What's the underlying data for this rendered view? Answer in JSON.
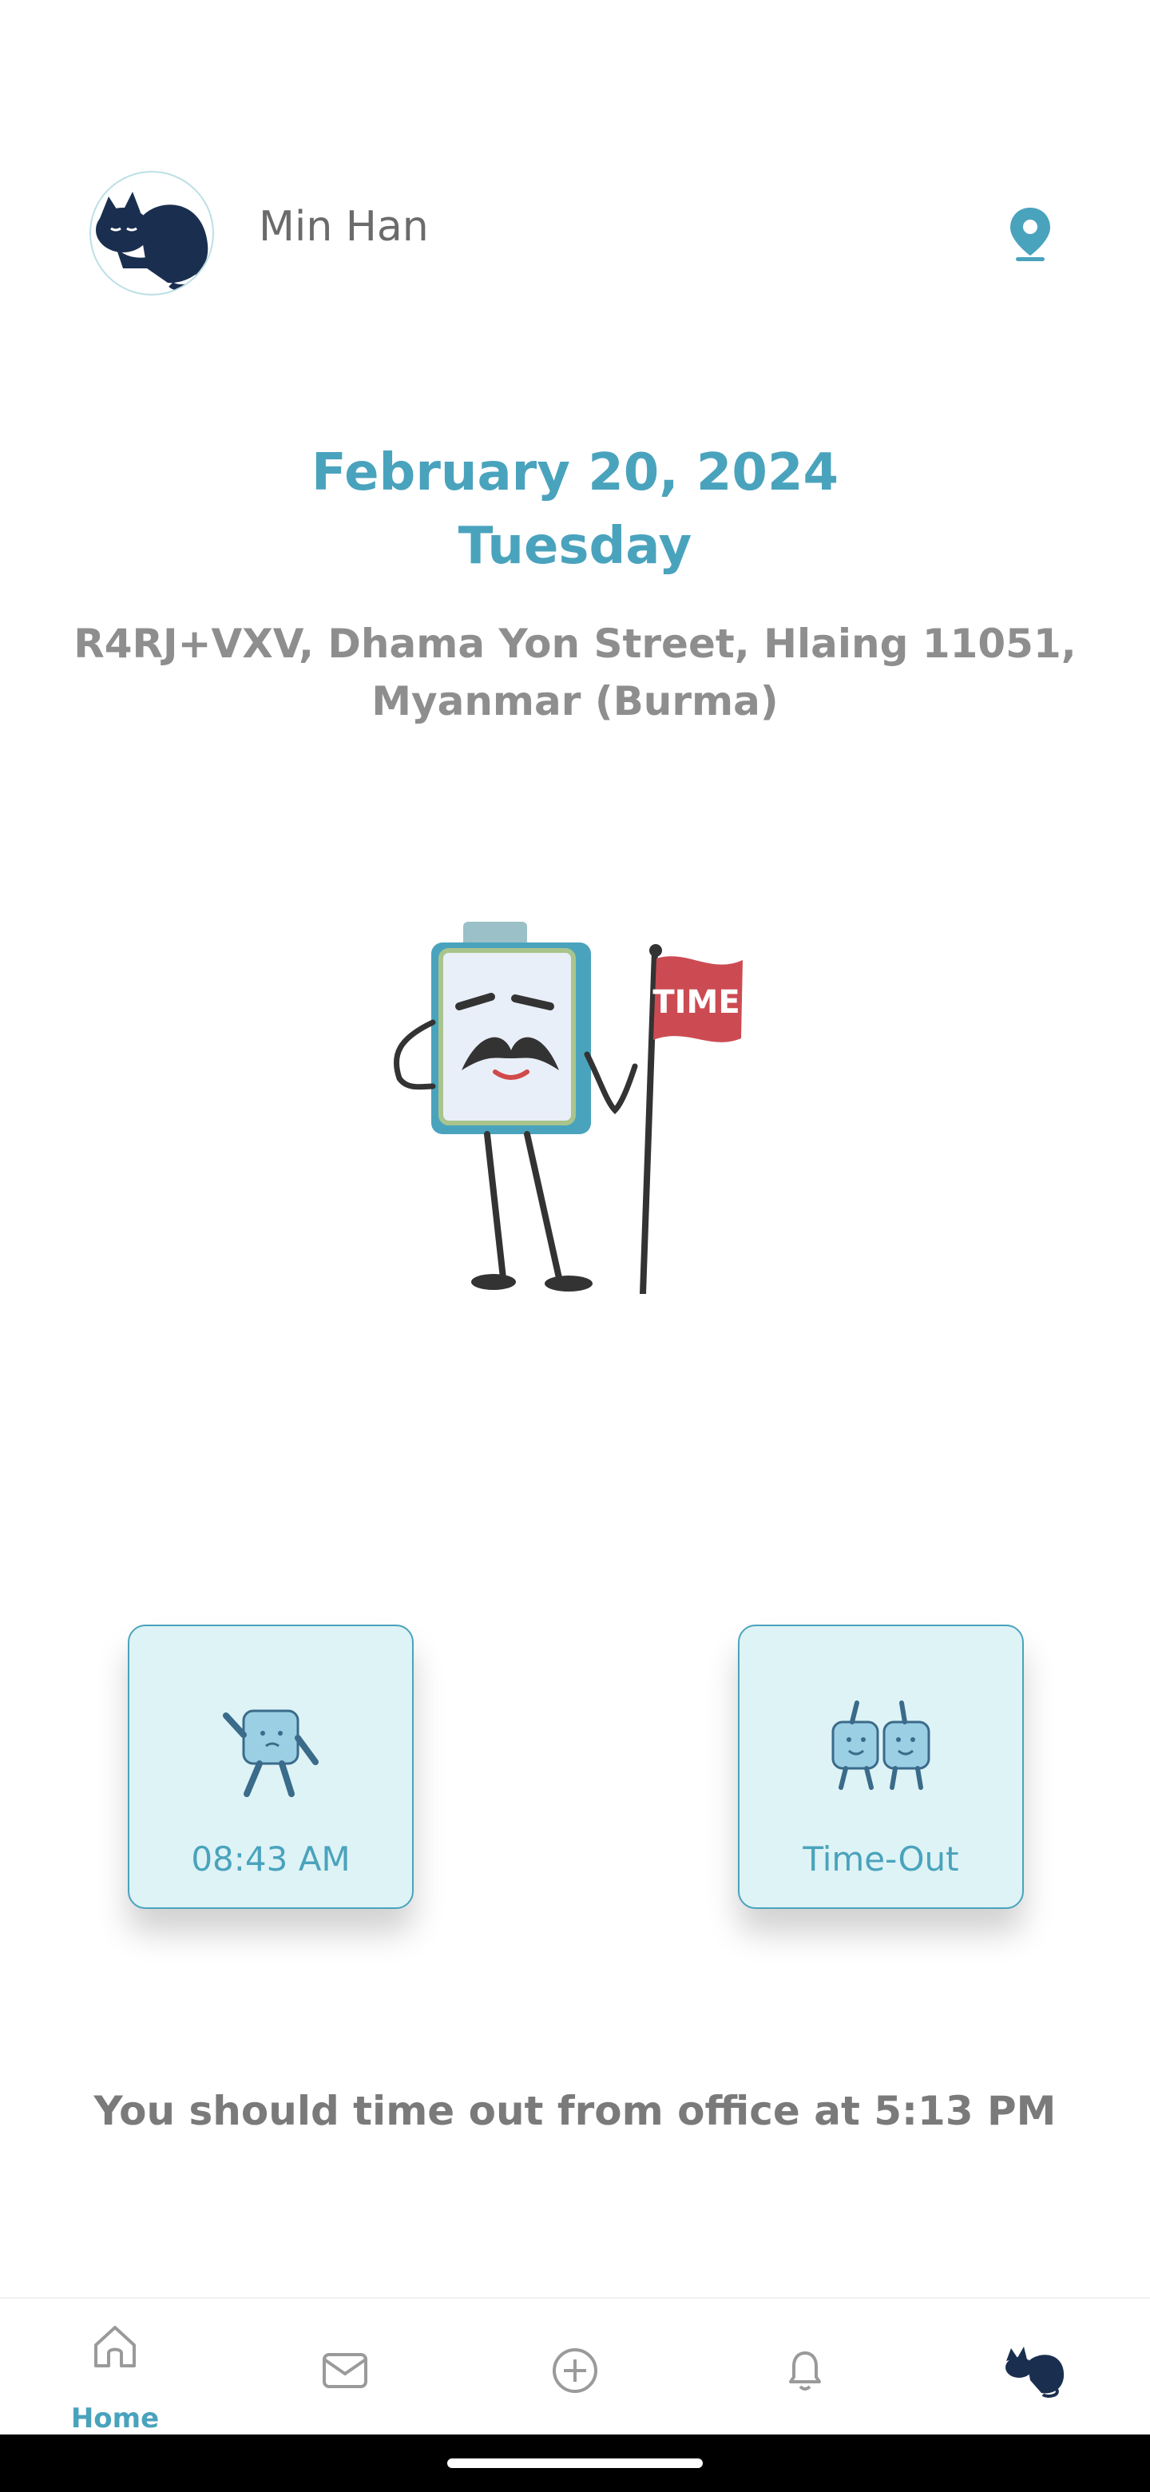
{
  "header": {
    "user_name": "Min Han",
    "avatar_icon": "sleeping-cat-avatar",
    "location_icon": "map-pin-icon"
  },
  "main": {
    "date": "February 20, 2024",
    "weekday": "Tuesday",
    "address": "R4RJ+VXV, Dhama Yon Street, Hlaing 11051, Myanmar (Burma)",
    "illustration": {
      "flag_text": "TIME"
    }
  },
  "cards": {
    "time_in": {
      "label": "08:43 AM"
    },
    "time_out": {
      "label": "Time-Out"
    }
  },
  "reminder": "You should time out from office at 5:13 PM",
  "nav": {
    "home_label": "Home",
    "items": [
      "home-icon",
      "mail-icon",
      "add-icon",
      "bell-icon",
      "profile-cat-icon"
    ]
  },
  "colors": {
    "accent": "#4aa3bd",
    "card_bg": "#def3f6",
    "text_gray": "#7a7a7a"
  }
}
